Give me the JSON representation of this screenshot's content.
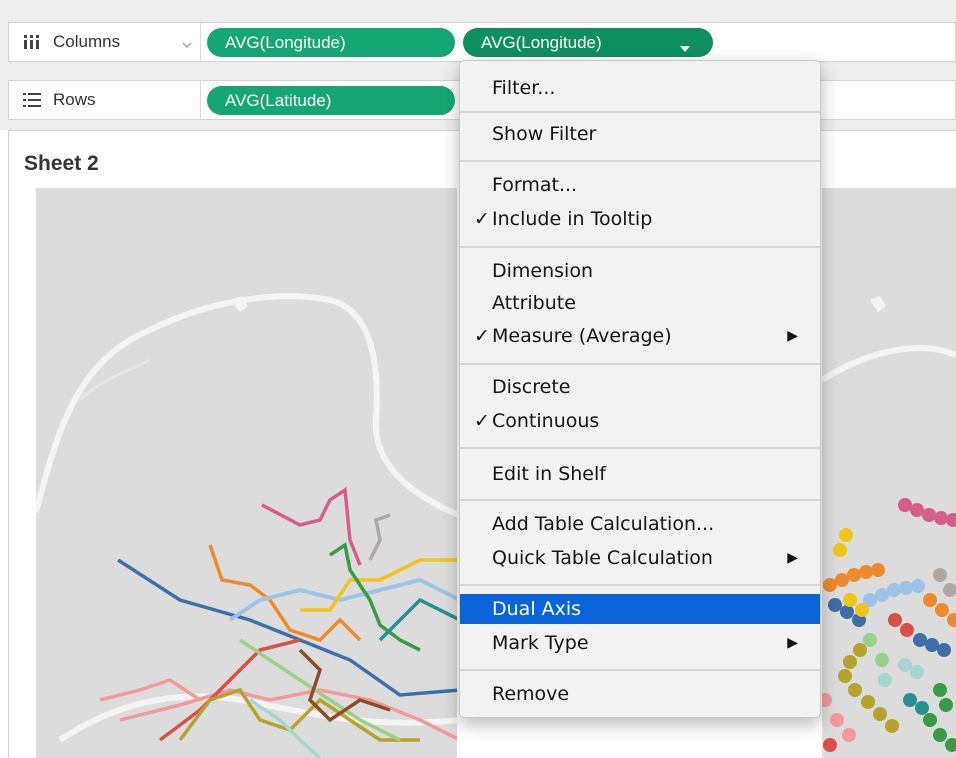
{
  "shelves": {
    "columns": {
      "label": "Columns",
      "pills": [
        "AVG(Longitude)",
        "AVG(Longitude)"
      ]
    },
    "rows": {
      "label": "Rows",
      "pills": [
        "AVG(Latitude)"
      ]
    }
  },
  "sheet": {
    "title": "Sheet 2"
  },
  "context_menu": {
    "filter": "Filter...",
    "show_filter": "Show Filter",
    "format": "Format...",
    "include_in_tooltip": "Include in Tooltip",
    "dimension": "Dimension",
    "attribute": "Attribute",
    "measure": "Measure (Average)",
    "discrete": "Discrete",
    "continuous": "Continuous",
    "edit_in_shelf": "Edit in Shelf",
    "add_table_calculation": "Add Table Calculation...",
    "quick_table_calculation": "Quick Table Calculation",
    "dual_axis": "Dual Axis",
    "mark_type": "Mark Type",
    "remove": "Remove",
    "checkmark": "✓",
    "submenu_arrow": "▶",
    "highlighted_item": "Dual Axis"
  },
  "colors": {
    "pill": "#14a774",
    "menu_highlight": "#0b63d9",
    "map_background": "#dcdcdc"
  }
}
